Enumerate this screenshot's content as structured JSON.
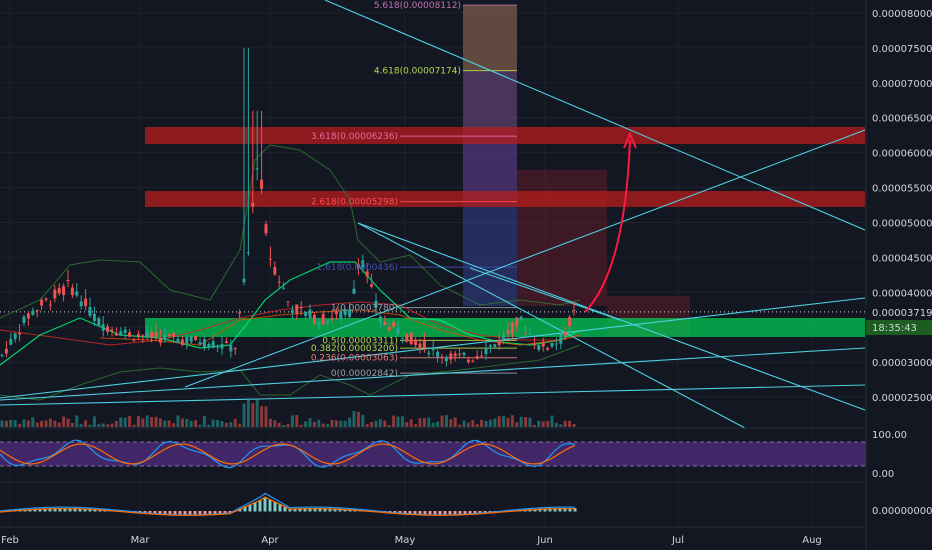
{
  "chart_data": {
    "type": "candlestick",
    "price_axis_labels": [
      "0.00008000",
      "0.00007500",
      "0.00007000",
      "0.00006500",
      "0.00006000",
      "0.00005500",
      "0.00005000",
      "0.00004500",
      "0.00004000",
      "0.00003500",
      "0.00003000",
      "0.00002500"
    ],
    "date_axis_labels": [
      "Feb",
      "Mar",
      "Apr",
      "May",
      "Jun",
      "Jul",
      "Aug"
    ],
    "last_price": "0.00003719",
    "countdown": "18:35:43",
    "fib_levels": [
      {
        "label": "5.618(0.00008112)",
        "value": 8.112e-05,
        "color": "#c36eb2"
      },
      {
        "label": "4.618(0.00007174)",
        "value": 7.174e-05,
        "color": "#b3d94a"
      },
      {
        "label": "3.618(0.00006236)",
        "value": 6.236e-05,
        "color": "#e36ea8"
      },
      {
        "label": "2.618(0.00005298)",
        "value": 5.298e-05,
        "color": "#ff4d4d"
      },
      {
        "label": "1.618(0.0000436)",
        "value": 4.36e-05,
        "color": "#3f51b5"
      },
      {
        "label": "1(0.00003780)",
        "value": 3.78e-05,
        "color": "#9aa0aa"
      },
      {
        "label": "0.5(0.00003311)",
        "value": 3.311e-05,
        "color": "#b3d94a"
      },
      {
        "label": "0.382(0.00003200)",
        "value": 3.2e-05,
        "color": "#b3d94a"
      },
      {
        "label": "0.236(0.00003063)",
        "value": 3.063e-05,
        "color": "#f07c7c"
      },
      {
        "label": "0(0.00002842)",
        "value": 2.842e-05,
        "color": "#9aa0aa"
      }
    ],
    "stoch_axis_labels": [
      "100.00",
      "0.00"
    ],
    "macd_axis_label": "0.00000000",
    "price_ylim": [
      2.2e-05,
      8.3e-05
    ],
    "colors": {
      "up": "#26a69a",
      "down": "#ef5350",
      "resistance_zone": "#b71c1c",
      "support_zone": "#00c853",
      "trendline": "#4dd0e1",
      "projection_arrow": "#ff1744",
      "stoch_band": "#4a2a73"
    }
  }
}
